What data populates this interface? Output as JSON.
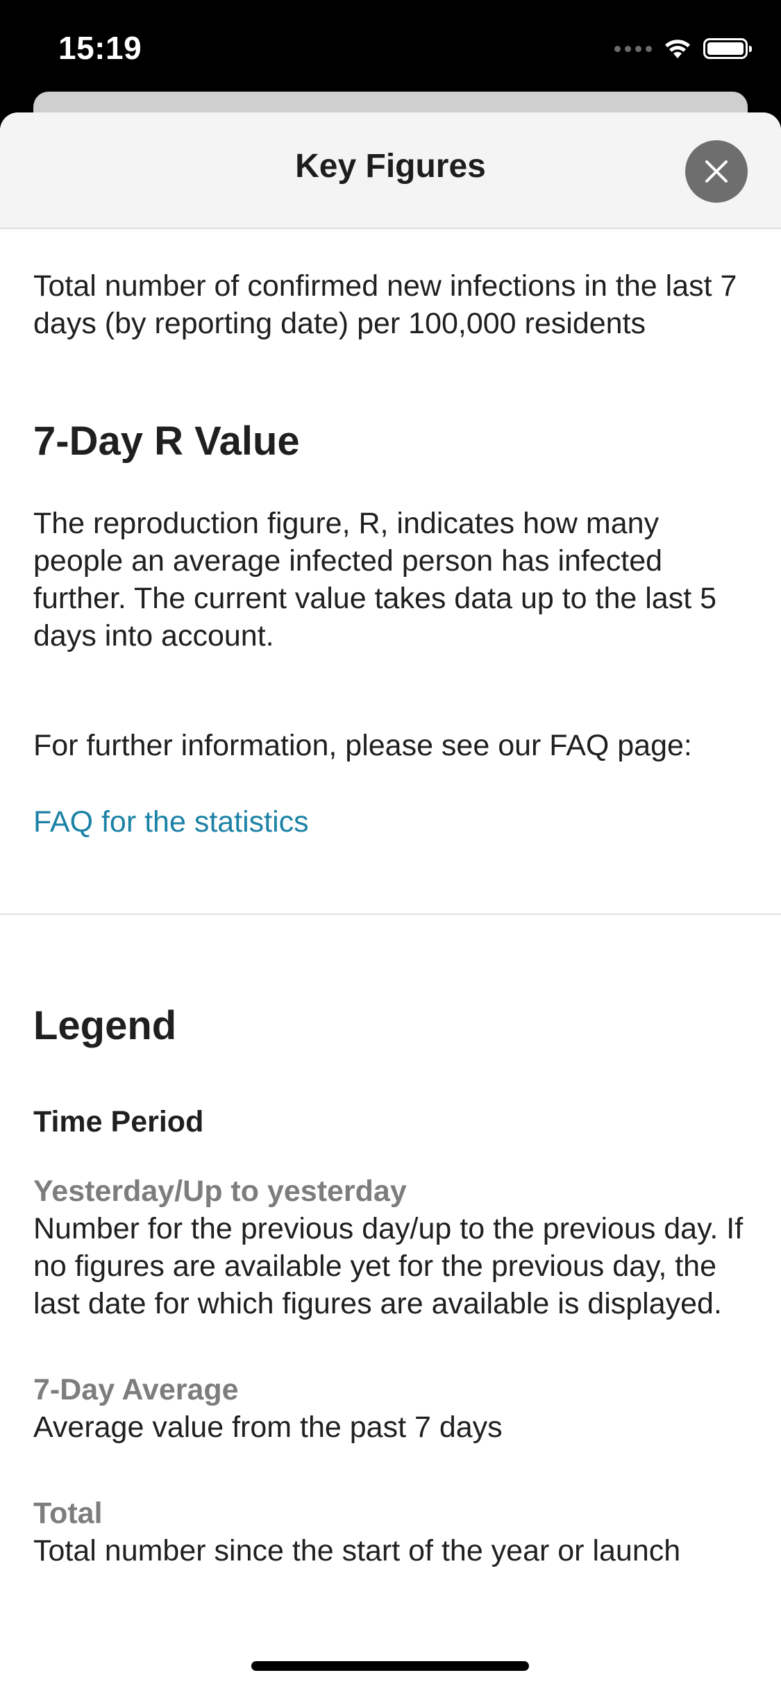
{
  "status_bar": {
    "time": "15:19"
  },
  "sheet": {
    "title": "Key Figures",
    "close_icon": "close-icon"
  },
  "incidence": {
    "description": "Total number of confirmed new infections in the last 7 days (by reporting date) per 100,000 residents"
  },
  "r_value": {
    "heading": "7-Day R Value",
    "description": "The reproduction figure, R, indicates how many people an average infected person has infected further. The current value takes data up to the last 5 days into account.",
    "further_info": "For further information, please see our FAQ page:",
    "faq_link": "FAQ for the statistics"
  },
  "legend": {
    "heading": "Legend",
    "time_period_heading": "Time Period",
    "items": [
      {
        "title": "Yesterday/Up to yesterday",
        "description": "Number for the previous day/up to the previous day. If no figures are available yet for the previous day, the last date for which figures are available is displayed."
      },
      {
        "title": "7-Day Average",
        "description": "Average value from the past 7 days"
      },
      {
        "title": "Total",
        "description": "Total number since the start of the year or launch"
      }
    ]
  },
  "colors": {
    "link": "#1c82a6",
    "close_button": "#6e6e6e",
    "subhead": "#7d7d7d",
    "header_bg": "#f4f4f4"
  }
}
